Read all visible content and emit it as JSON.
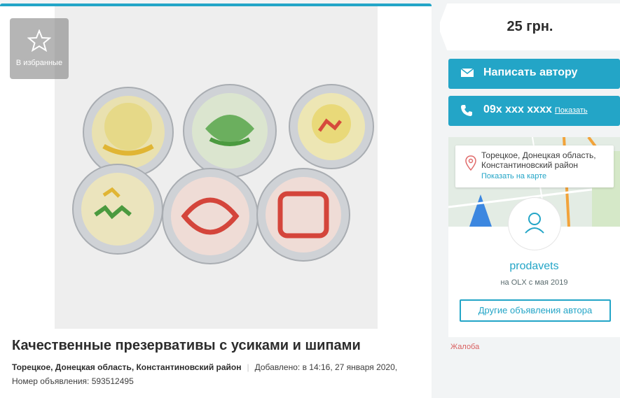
{
  "favorites": {
    "label": "В избранные",
    "icon": "star-icon"
  },
  "ad": {
    "title": "Качественные презервативы с усиками и шипами",
    "location": "Торецкое, Донецкая область, Константиновский район",
    "added": "Добавлено: в 14:16, 27 января 2020,",
    "number": "Номер объявления: 593512495"
  },
  "sidebar": {
    "price": "25 грн.",
    "message_button": "Написать автору",
    "phone_number": "09x xxx xxxx",
    "phone_show": "Показать",
    "location_address": "Торецкое, Донецкая область, Константиновский район",
    "show_on_map": "Показать на карте",
    "seller_name": "prodavets",
    "seller_since": "на OLX с мая 2019",
    "other_ads_button": "Другие объявления автора",
    "complaint": "Жалоба"
  },
  "colors": {
    "accent": "#23a5c7",
    "complaint": "#d96060",
    "background": "#f2f4f5"
  }
}
